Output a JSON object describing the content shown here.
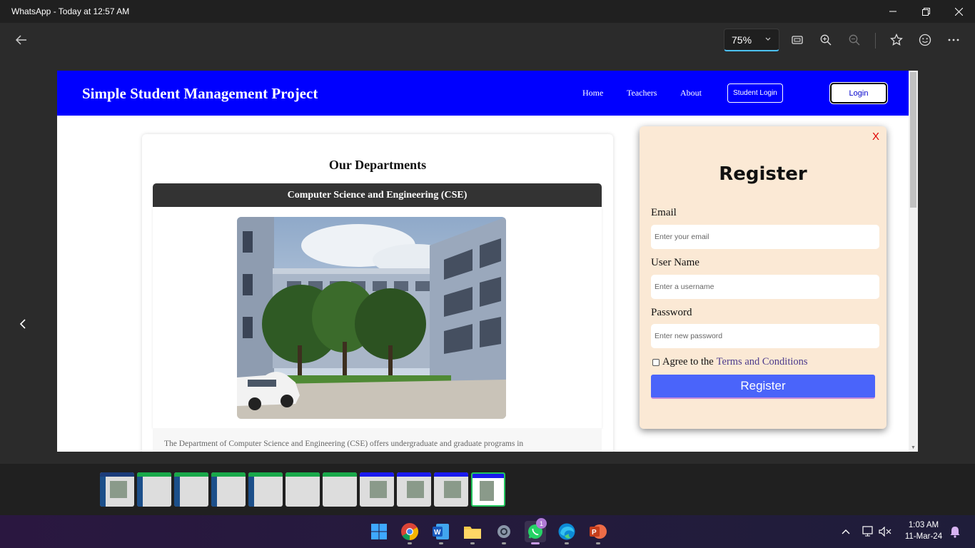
{
  "window": {
    "title": "WhatsApp - Today at 12:57 AM"
  },
  "toolbar": {
    "zoom_value": "75%"
  },
  "site": {
    "title": "Simple Student Management Project",
    "nav": [
      "Home",
      "Teachers",
      "About"
    ],
    "student_login": "Student Login",
    "login": "Login"
  },
  "departments": {
    "heading": "Our Departments",
    "dept_name": "Computer Science and Engineering (CSE)",
    "description": "The Department of Computer Science and Engineering (CSE) offers undergraduate and graduate programs in"
  },
  "register": {
    "close": "X",
    "title": "Register",
    "email_label": "Email",
    "email_placeholder": "Enter your email",
    "username_label": "User Name",
    "username_placeholder": "Enter a username",
    "password_label": "Password",
    "password_placeholder": "Enter new password",
    "agree_text": "Agree to the",
    "terms_link": "Terms and Conditions",
    "submit": "Register"
  },
  "taskbar": {
    "whatsapp_badge": "1",
    "time": "1:03 AM",
    "date": "11-Mar-24"
  },
  "colors": {
    "site_header": "#0000ff",
    "modal_bg": "#fbe9d5",
    "register_button": "#4a64fa",
    "close_x": "#e00000",
    "zoom_accent": "#4cc2ff"
  }
}
